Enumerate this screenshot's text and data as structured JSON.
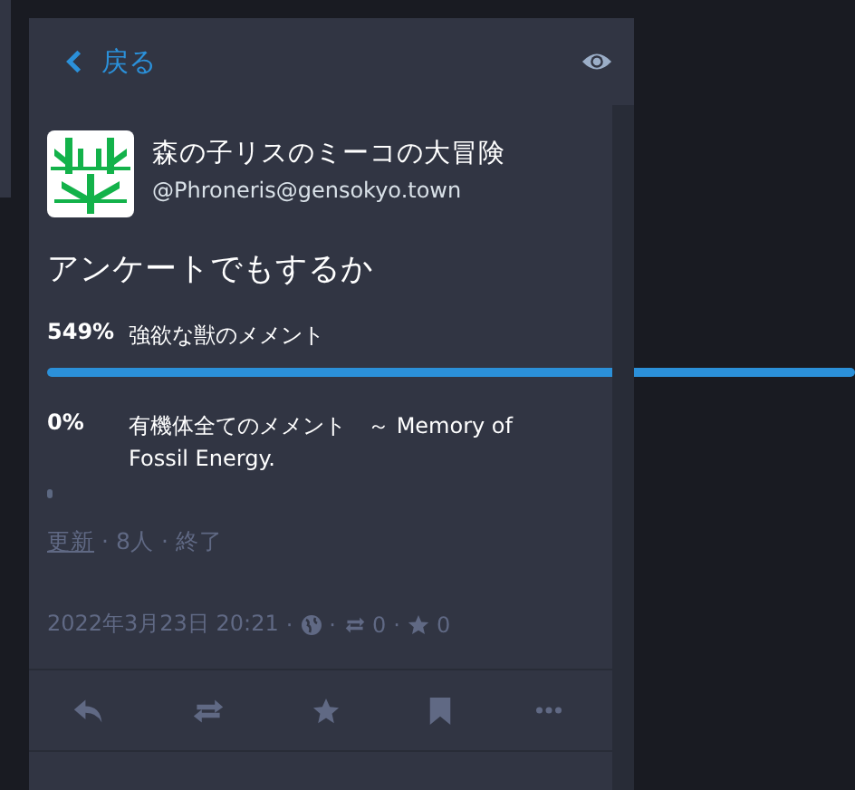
{
  "header": {
    "back_label": "戻る"
  },
  "account": {
    "display_name": "森の子リスのミーコの大冒険",
    "handle": "@Phroneris@gensokyo.town"
  },
  "status": {
    "text": "アンケートでもするか"
  },
  "poll": {
    "options": [
      {
        "percent": "549%",
        "label": "強欲な獣のメメント",
        "leading": true
      },
      {
        "percent": "0%",
        "label": "有機体全てのメメント　～ Memory of Fossil Energy.",
        "leading": false
      }
    ],
    "refresh": "更新",
    "voters": "8人",
    "closed": "終了",
    "separators": [
      "·",
      "·"
    ]
  },
  "meta": {
    "date": "2022年3月23日 20:21",
    "boosts": "0",
    "favourites": "0",
    "separators": [
      "·",
      "·",
      "·"
    ]
  }
}
